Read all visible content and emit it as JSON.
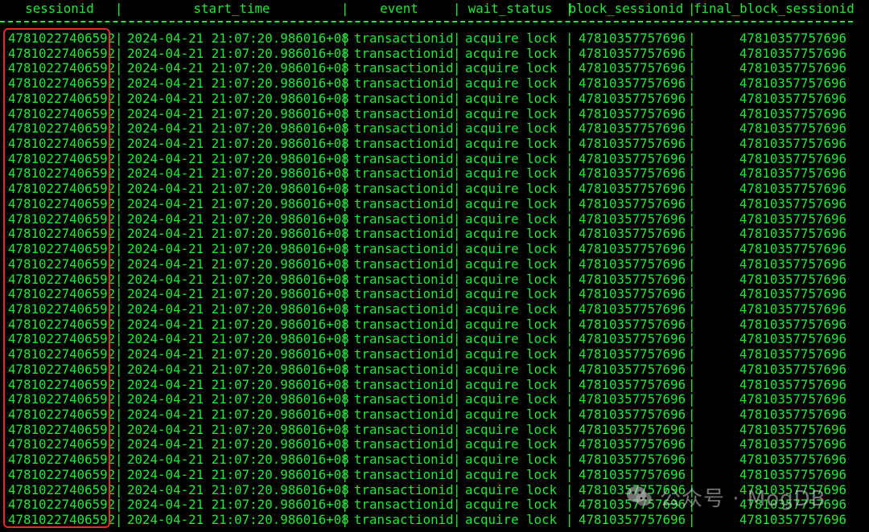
{
  "terminal": {
    "text_color": "#22e838",
    "background": "#000000",
    "highlight_color": "#e0302c"
  },
  "columns": {
    "sessionid": "sessionid",
    "start_time": "start_time",
    "event": "event",
    "wait_status": "wait_status",
    "block_sessionid": "block_sessionid",
    "final_block_sessionid": "final_block_sessionid"
  },
  "separator": "|",
  "row": {
    "sessionid": "47810227406592",
    "start_time": "2024-04-21 21:07:20.986016+08",
    "event": "transactionid",
    "wait_status": "acquire lock",
    "block_sessionid": "47810357757696",
    "final_block_sessionid": "47810357757696"
  },
  "row_count": 33,
  "watermark": {
    "icon": "wechat-icon",
    "text": "公众号 · MogDB"
  }
}
